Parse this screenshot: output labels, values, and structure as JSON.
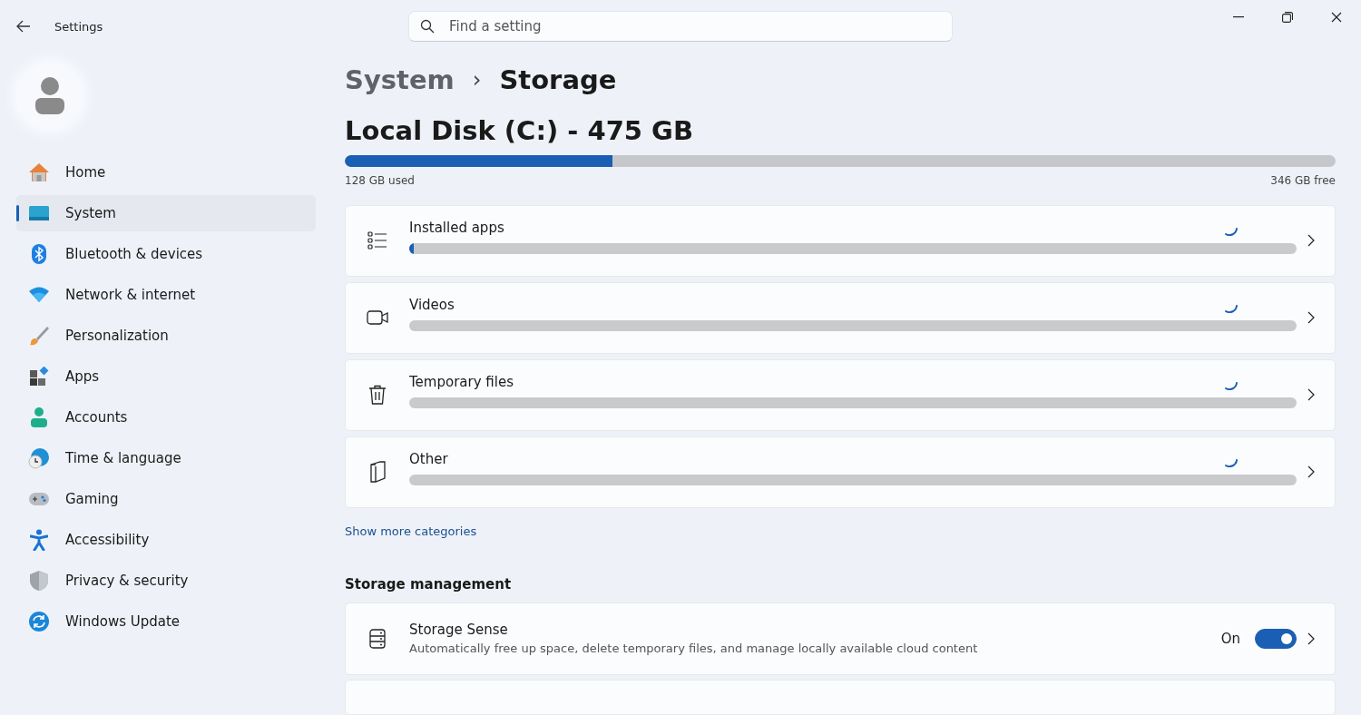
{
  "window": {
    "title": "Settings"
  },
  "search": {
    "placeholder": "Find a setting"
  },
  "sidebar": {
    "items": [
      {
        "label": "Home",
        "selected": false
      },
      {
        "label": "System",
        "selected": true
      },
      {
        "label": "Bluetooth & devices",
        "selected": false
      },
      {
        "label": "Network & internet",
        "selected": false
      },
      {
        "label": "Personalization",
        "selected": false
      },
      {
        "label": "Apps",
        "selected": false
      },
      {
        "label": "Accounts",
        "selected": false
      },
      {
        "label": "Time & language",
        "selected": false
      },
      {
        "label": "Gaming",
        "selected": false
      },
      {
        "label": "Accessibility",
        "selected": false
      },
      {
        "label": "Privacy & security",
        "selected": false
      },
      {
        "label": "Windows Update",
        "selected": false
      }
    ]
  },
  "breadcrumb": {
    "parent": "System",
    "separator": "›",
    "current": "Storage"
  },
  "disk": {
    "title": "Local Disk (C:) - 475 GB",
    "level": 0.27,
    "used": "128 GB used",
    "free": "346 GB free"
  },
  "categories": [
    {
      "label": "Installed apps",
      "level": 0.005
    },
    {
      "label": "Videos",
      "level": 0
    },
    {
      "label": "Temporary files",
      "level": 0
    },
    {
      "label": "Other",
      "level": 0
    }
  ],
  "show_more": "Show more categories",
  "storage_management": {
    "heading": "Storage management",
    "items": [
      {
        "title": "Storage Sense",
        "description": "Automatically free up space, delete temporary files, and manage locally available cloud content",
        "state_label": "On",
        "on": true
      }
    ]
  }
}
